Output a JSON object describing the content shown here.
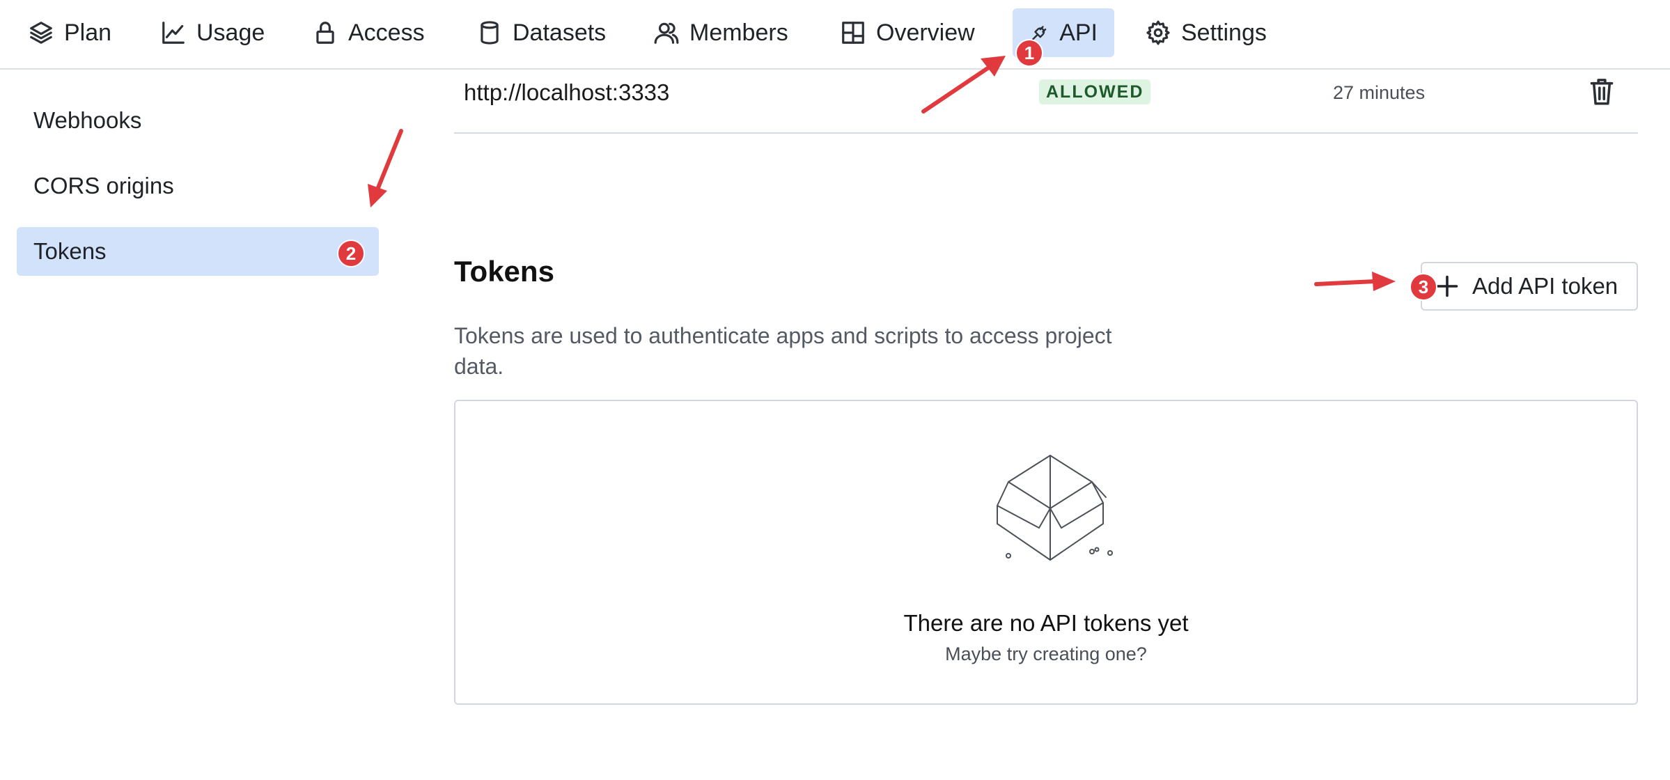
{
  "topnav": {
    "tabs": [
      {
        "label": "Plan",
        "icon": "layers-icon"
      },
      {
        "label": "Usage",
        "icon": "line-chart-icon"
      },
      {
        "label": "Access",
        "icon": "lock-icon"
      },
      {
        "label": "Datasets",
        "icon": "database-icon"
      },
      {
        "label": "Members",
        "icon": "users-icon"
      },
      {
        "label": "Overview",
        "icon": "layout-grid-icon"
      },
      {
        "label": "API",
        "icon": "plug-icon",
        "active": true
      },
      {
        "label": "Settings",
        "icon": "gear-icon"
      }
    ]
  },
  "sidebar": {
    "items": [
      {
        "label": "Webhooks"
      },
      {
        "label": "CORS origins"
      },
      {
        "label": "Tokens",
        "active": true
      }
    ]
  },
  "cors": {
    "origin": "http://localhost:3333",
    "status": "ALLOWED",
    "age": "27 minutes",
    "delete_icon": "trash-icon"
  },
  "tokens": {
    "heading": "Tokens",
    "add_button_label": "Add API token",
    "description": "Tokens are used to authenticate apps and scripts to access project data.",
    "empty_title": "There are no API tokens yet",
    "empty_subtitle": "Maybe try creating one?",
    "empty_icon": "open-box-icon"
  },
  "annotations": {
    "badges": [
      "1",
      "2",
      "3"
    ],
    "color": "#e03a3e"
  },
  "colors": {
    "active_bg": "#d3e2fb",
    "badge_bg": "#dff3e3",
    "badge_text": "#1d5a2b"
  }
}
